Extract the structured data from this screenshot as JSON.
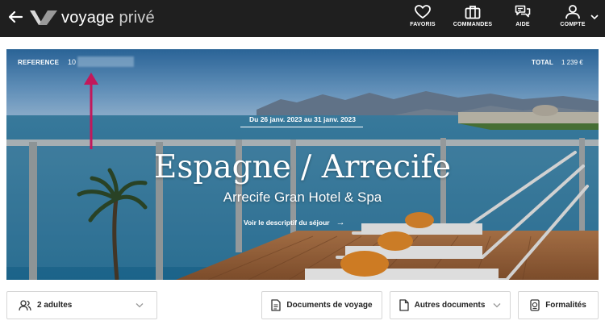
{
  "header": {
    "brand_main": "voyage",
    "brand_light": "privé",
    "nav": [
      {
        "label": "FAVORIS",
        "icon": "heart-icon"
      },
      {
        "label": "COMMANDES",
        "icon": "briefcase-icon"
      },
      {
        "label": "AIDE",
        "icon": "chat-icon"
      },
      {
        "label": "COMPTE",
        "icon": "user-icon"
      }
    ]
  },
  "hero": {
    "reference_label": "REFERENCE",
    "reference_value": "10",
    "total_label": "TOTAL",
    "total_value": "1 239 €",
    "dates": "Du 26 janv. 2023 au 31 janv. 2023",
    "title": "Espagne / Arrecife",
    "subtitle": "Arrecife Gran Hotel & Spa",
    "link": "Voir le descriptif du séjour",
    "link_arrow": "→"
  },
  "actions": {
    "travelers": "2 adultes",
    "travel_docs": "Documents de voyage",
    "other_docs": "Autres documents",
    "formalities": "Formalités"
  },
  "colors": {
    "topbar": "#1f1f1f",
    "annotation_arrow": "#c2185b"
  }
}
